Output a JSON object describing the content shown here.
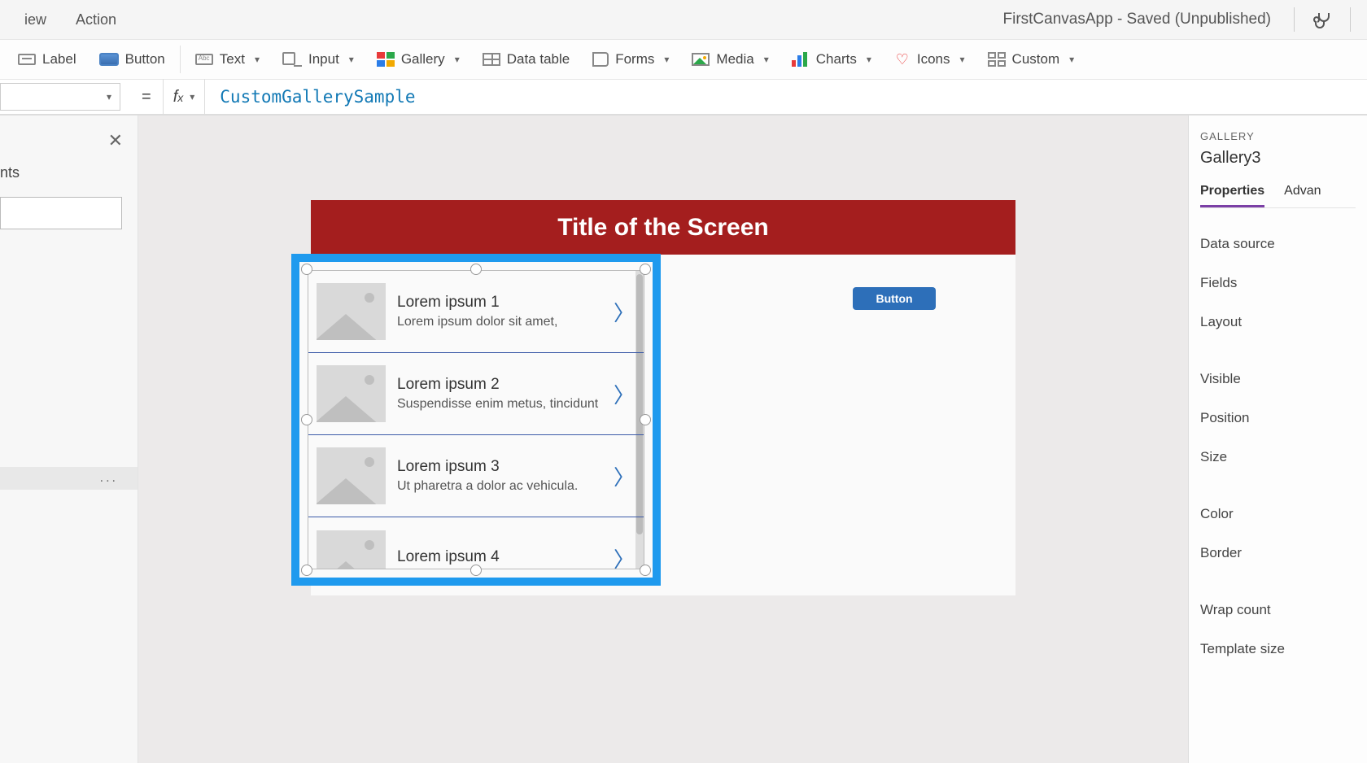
{
  "menubar": {
    "view": "iew",
    "action": "Action",
    "apptitle": "FirstCanvasApp - Saved (Unpublished)"
  },
  "ribbon": {
    "label": "Label",
    "button": "Button",
    "text": "Text",
    "input": "Input",
    "gallery": "Gallery",
    "datatable": "Data table",
    "forms": "Forms",
    "media": "Media",
    "charts": "Charts",
    "icons": "Icons",
    "custom": "Custom"
  },
  "formula": {
    "value": "CustomGallerySample"
  },
  "leftpane": {
    "header": "nts",
    "ellipsis": "..."
  },
  "screen": {
    "title": "Title of the Screen",
    "button": "Button"
  },
  "gallery": {
    "items": [
      {
        "title": "Lorem ipsum 1",
        "sub": "Lorem ipsum dolor sit amet,"
      },
      {
        "title": "Lorem ipsum 2",
        "sub": "Suspendisse enim metus, tincidunt"
      },
      {
        "title": "Lorem ipsum 3",
        "sub": "Ut pharetra a dolor ac vehicula."
      },
      {
        "title": "Lorem ipsum 4",
        "sub": ""
      }
    ]
  },
  "rightpane": {
    "category": "GALLERY",
    "name": "Gallery3",
    "tab_props": "Properties",
    "tab_adv": "Advan",
    "props": {
      "datasource": "Data source",
      "fields": "Fields",
      "layout": "Layout",
      "visible": "Visible",
      "position": "Position",
      "size": "Size",
      "color": "Color",
      "border": "Border",
      "wrapcount": "Wrap count",
      "templatesize": "Template size"
    }
  }
}
